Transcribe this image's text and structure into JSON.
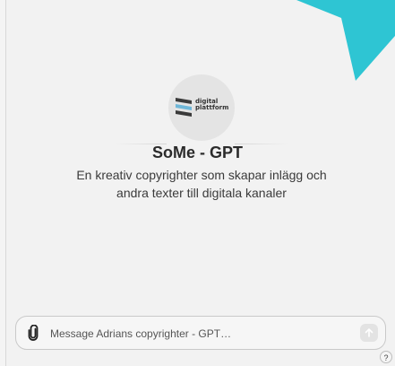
{
  "colors": {
    "accent": "#2ec5d3",
    "logo_blue": "#6fb7d8",
    "logo_dark": "#3a3a3a"
  },
  "gpt": {
    "logo_text_line1": "digital",
    "logo_text_line2": "plattform",
    "title": "SoMe - GPT",
    "description": "En kreativ copyrighter som skapar inlägg och andra texter till digitala kanaler"
  },
  "composer": {
    "placeholder": "Message Adrians copyrighter - GPT…",
    "attach_icon": "paperclip-icon",
    "send_icon": "arrow-up-icon"
  },
  "help": {
    "label": "?"
  }
}
